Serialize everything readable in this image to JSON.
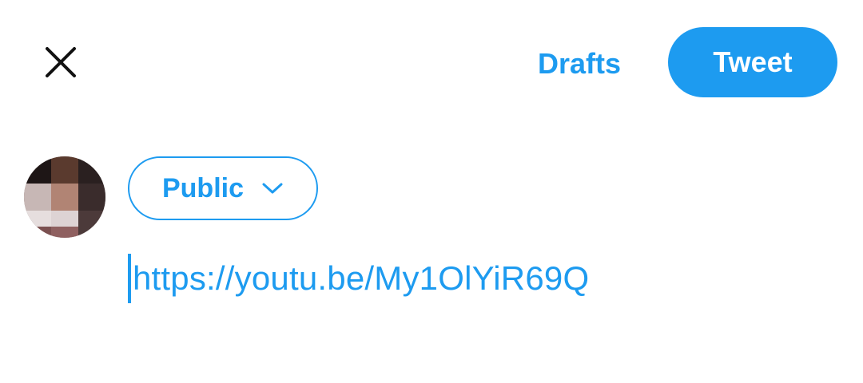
{
  "header": {
    "close_icon": "close-icon",
    "drafts_label": "Drafts",
    "tweet_label": "Tweet"
  },
  "composer": {
    "avatar_icon": "avatar",
    "audience_label": "Public",
    "audience_icon": "chevron-down-icon",
    "text": "https://youtu.be/My1OlYiR69Q"
  },
  "colors": {
    "accent": "#1d9bf0",
    "background": "#ffffff",
    "icon": "#111111"
  }
}
